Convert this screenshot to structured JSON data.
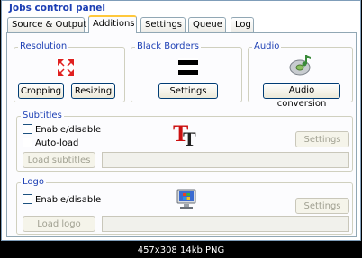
{
  "window": {
    "title": "Jobs control panel"
  },
  "tabs": [
    {
      "label": "Source & Output",
      "active": false
    },
    {
      "label": "Additions",
      "active": true
    },
    {
      "label": "Settings",
      "active": false
    },
    {
      "label": "Queue",
      "active": false
    },
    {
      "label": "Log",
      "active": false
    }
  ],
  "resolution": {
    "title": "Resolution",
    "icon": "resize-arrows-icon",
    "cropping_label": "Cropping",
    "resizing_label": "Resizing"
  },
  "black_borders": {
    "title": "Black Borders",
    "icon": "black-bars-icon",
    "settings_label": "Settings"
  },
  "audio": {
    "title": "Audio",
    "icon": "audio-cd-icon",
    "conversion_label": "Audio conversion"
  },
  "subtitles": {
    "title": "Subtitles",
    "icon": "font-tt-icon",
    "enable_label": "Enable/disable",
    "autoload_label": "Auto-load",
    "load_label": "Load subtitles",
    "settings_label": "Settings"
  },
  "logo": {
    "title": "Logo",
    "icon": "monitor-logo-icon",
    "enable_label": "Enable/disable",
    "load_label": "Load logo",
    "settings_label": "Settings"
  },
  "footer": {
    "caption": "457x308  14kb  PNG"
  },
  "colors": {
    "accent": "#1c3fb4",
    "tab_highlight": "#ffc83c",
    "border": "#7f9db9"
  }
}
